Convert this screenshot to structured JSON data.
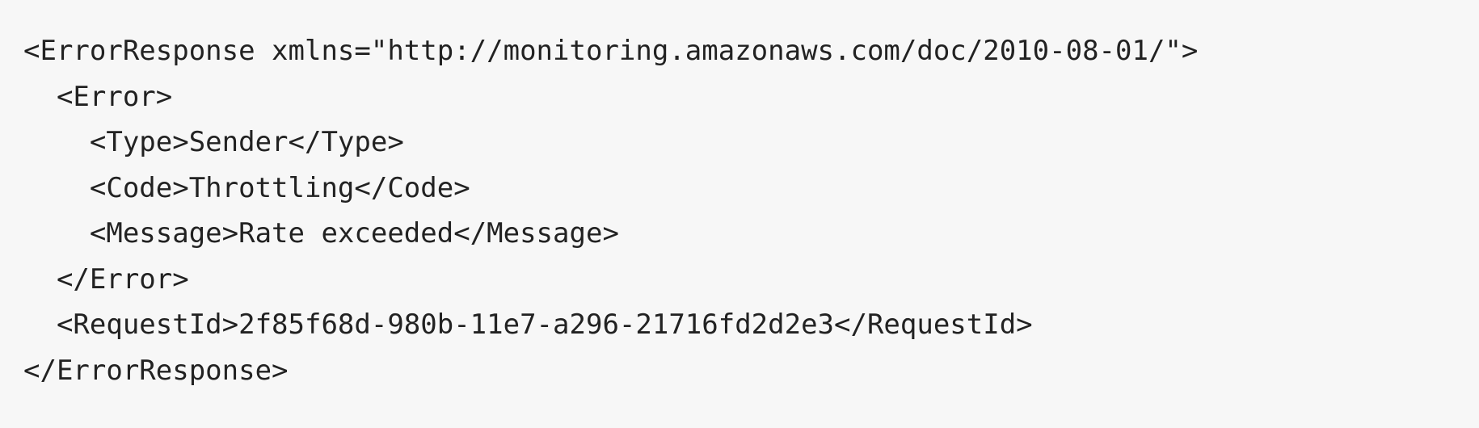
{
  "code": {
    "lines": [
      "<ErrorResponse xmlns=\"http://monitoring.amazonaws.com/doc/2010-08-01/\">",
      "  <Error>",
      "    <Type>Sender</Type>",
      "    <Code>Throttling</Code>",
      "    <Message>Rate exceeded</Message>",
      "  </Error>",
      "  <RequestId>2f85f68d-980b-11e7-a296-21716fd2d2e3</RequestId>",
      "</ErrorResponse>"
    ]
  },
  "colors": {
    "background": "#f7f7f7",
    "text": "#222222"
  }
}
